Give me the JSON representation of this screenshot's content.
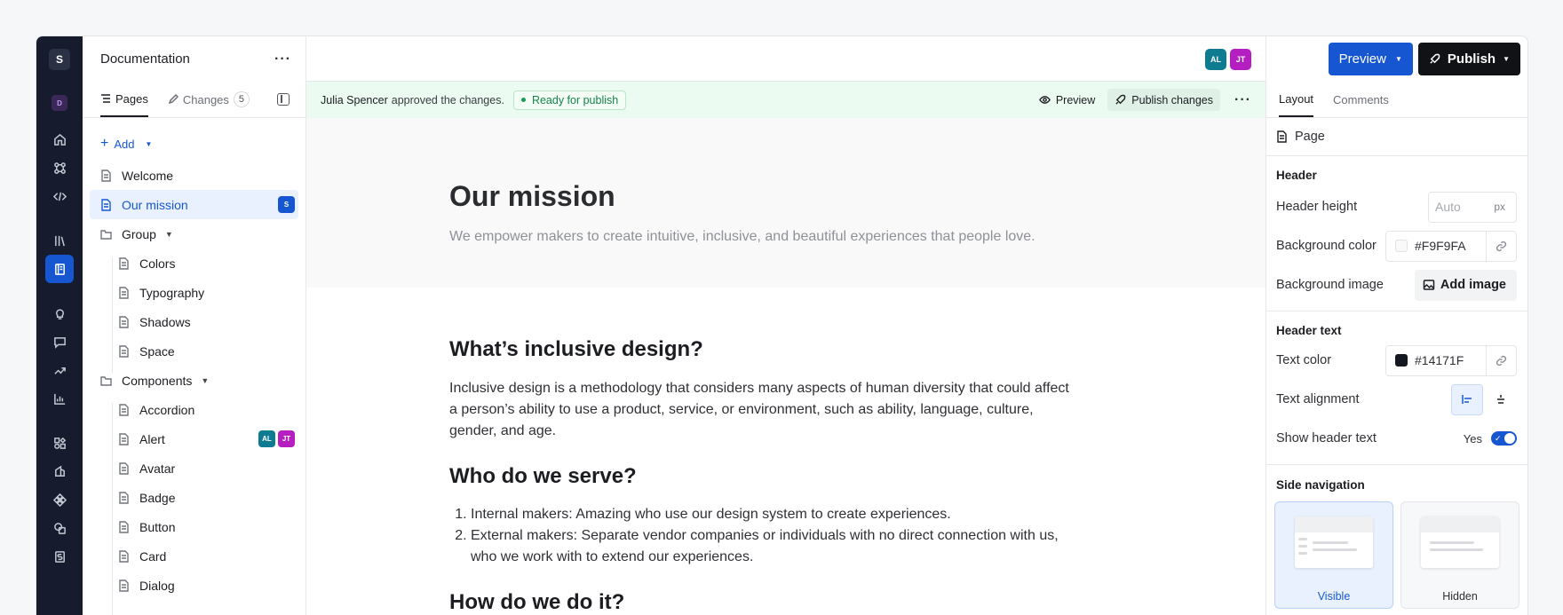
{
  "rail": {
    "logo": "S",
    "workspace": "D",
    "icons": [
      "home-icon",
      "shortcut-icon",
      "code-icon",
      "library-icon",
      "docs-icon",
      "lightbulb-icon",
      "feedback-icon",
      "trend-icon",
      "chart-icon",
      "components-icon",
      "tokens-icon",
      "figma-icon",
      "assets-icon",
      "storybook-icon"
    ]
  },
  "tree": {
    "title": "Documentation",
    "tabs": {
      "pages": "Pages",
      "changes": "Changes",
      "changes_count": "5"
    },
    "add_label": "Add",
    "items": [
      {
        "label": "Welcome"
      },
      {
        "label": "Our mission",
        "badge": "S"
      },
      {
        "label": "Group"
      },
      {
        "label": "Colors"
      },
      {
        "label": "Typography"
      },
      {
        "label": "Shadows"
      },
      {
        "label": "Space"
      },
      {
        "label": "Components"
      },
      {
        "label": "Accordion"
      },
      {
        "label": "Alert",
        "badges": [
          "AL",
          "JT"
        ]
      },
      {
        "label": "Avatar"
      },
      {
        "label": "Badge"
      },
      {
        "label": "Button"
      },
      {
        "label": "Card"
      },
      {
        "label": "Dialog"
      }
    ]
  },
  "topbar": {
    "avatars": [
      "AL",
      "JT"
    ]
  },
  "notice": {
    "name": "Julia Spencer",
    "message": "approved the changes.",
    "status": "Ready for publish",
    "preview": "Preview",
    "publish_changes": "Publish changes"
  },
  "page": {
    "title": "Our mission",
    "subtitle": "We empower makers to create intuitive, inclusive, and beautiful experiences that people love.",
    "h2_1": "What’s inclusive design?",
    "p_1": "Inclusive design is a methodology that considers many aspects of human diversity that could affect a person’s ability to use a product, service, or environment, such as ability, language, culture, gender, and age.",
    "h2_2": "Who do we serve?",
    "list": [
      "Internal makers: Amazing who use our design system to create experiences.",
      "External makers: Separate vendor companies or individuals with no direct connection with us, who we work with to extend our experiences."
    ],
    "h2_3": "How do we do it?"
  },
  "panel": {
    "preview_btn": "Preview",
    "publish_btn": "Publish",
    "tabs": {
      "layout": "Layout",
      "comments": "Comments"
    },
    "page_label": "Page",
    "header_section": "Header",
    "header_height": "Header height",
    "header_height_placeholder": "Auto",
    "header_height_unit": "px",
    "bg_color_label": "Background color",
    "bg_color_value": "#F9F9FA",
    "bg_image_label": "Background image",
    "add_image": "Add image",
    "header_text_section": "Header text",
    "text_color_label": "Text color",
    "text_color_value": "#14171F",
    "text_align_label": "Text alignment",
    "show_header_label": "Show header text",
    "show_header_value": "Yes",
    "side_nav_section": "Side navigation",
    "card_visible": "Visible",
    "card_hidden": "Hidden"
  },
  "colors": {
    "accent": "#1657d1",
    "notice_bg": "#ecfbf1",
    "status_green": "#17814b"
  }
}
